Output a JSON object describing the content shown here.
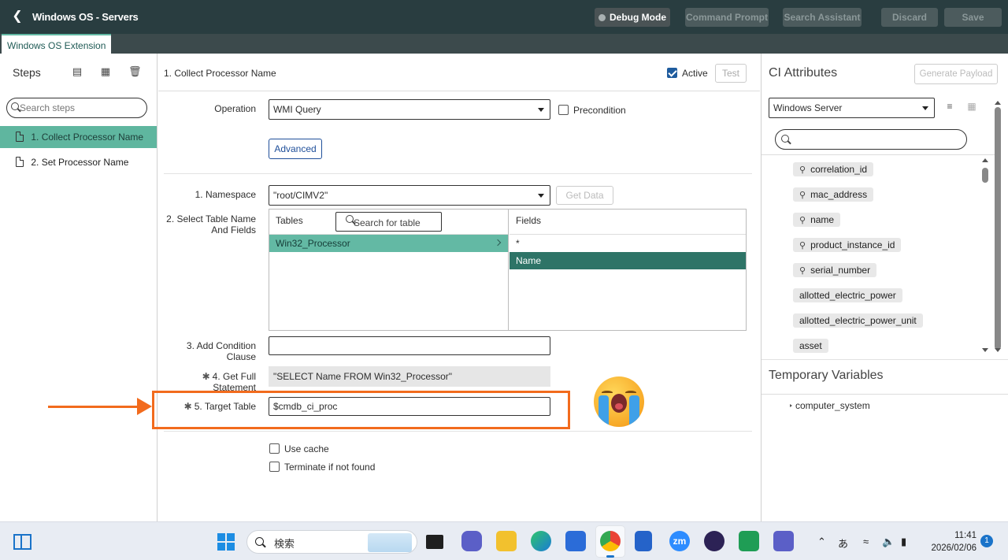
{
  "header": {
    "back_icon": "chevron-left-icon",
    "title": "Windows OS - Servers",
    "buttons": {
      "debug_mode": "Debug Mode",
      "command_prompt": "Command Prompt",
      "search_assistant": "Search Assistant",
      "discard": "Discard",
      "save": "Save"
    }
  },
  "tabs": [
    {
      "label": "Windows OS Extension",
      "active": true
    }
  ],
  "steps_panel": {
    "title": "Steps",
    "icons": [
      "add-step-icon",
      "insert-step-icon",
      "trash-icon"
    ],
    "search_placeholder": "Search steps",
    "items": [
      {
        "number": "1.",
        "label": "Collect Processor Name",
        "selected": true
      },
      {
        "number": "2.",
        "label": "Set Processor Name",
        "selected": false
      }
    ]
  },
  "step_editor": {
    "step_name": "1. Collect Processor Name",
    "active_label": "Active",
    "active_checked": true,
    "test_label": "Test",
    "operation": {
      "label": "Operation",
      "value": "WMI Query",
      "precondition_label": "Precondition",
      "precondition_checked": false
    },
    "advanced_label": "Advanced",
    "namespace": {
      "label": "1. Namespace",
      "value": "\"root/CIMV2\"",
      "get_data_label": "Get Data"
    },
    "select_table": {
      "label_line1": "2. Select Table Name",
      "label_line2": "And Fields",
      "tables_header": "Tables",
      "table_search_placeholder": "Search for table",
      "tables": [
        "Win32_Processor"
      ],
      "fields_header": "Fields",
      "fields": [
        "*",
        "Name"
      ],
      "selected_table": "Win32_Processor",
      "selected_field": "Name"
    },
    "condition": {
      "label_line1": "3. Add Condition",
      "label_line2": "Clause",
      "value": ""
    },
    "full_statement": {
      "label_line1": "4. Get Full",
      "label_line2": "Statement",
      "value": "\"SELECT Name FROM Win32_Processor\""
    },
    "target_table": {
      "label": "5. Target Table",
      "value": "$cmdb_ci_proc"
    },
    "use_cache_label": "Use cache",
    "terminate_label": "Terminate if not found"
  },
  "annotation": {
    "highlight_color": "#f26b1d",
    "emoji": "loudly-crying-face-icon"
  },
  "ci_panel": {
    "title": "CI Attributes",
    "generate_payload": "Generate Payload",
    "class_value": "Windows Server",
    "attributes": [
      {
        "name": "correlation_id",
        "key": true
      },
      {
        "name": "mac_address",
        "key": true
      },
      {
        "name": "name",
        "key": true
      },
      {
        "name": "product_instance_id",
        "key": true
      },
      {
        "name": "serial_number",
        "key": true
      },
      {
        "name": "allotted_electric_power",
        "key": false
      },
      {
        "name": "allotted_electric_power_unit",
        "key": false
      },
      {
        "name": "asset",
        "key": false
      }
    ],
    "temp_vars_title": "Temporary Variables",
    "temp_vars": [
      "computer_system"
    ]
  },
  "taskbar": {
    "search_text": "検索",
    "apps": [
      "task-view-icon",
      "chat-icon",
      "file-explorer-icon",
      "edge-icon",
      "store-icon",
      "chrome-icon",
      "notepad-icon",
      "zoom-icon",
      "eclipse-icon",
      "sheets-icon",
      "teams-icon"
    ],
    "zoom_label": "zm",
    "ime": "あ",
    "time": "11:41",
    "date": "2026/02/06",
    "notifications": "1"
  }
}
